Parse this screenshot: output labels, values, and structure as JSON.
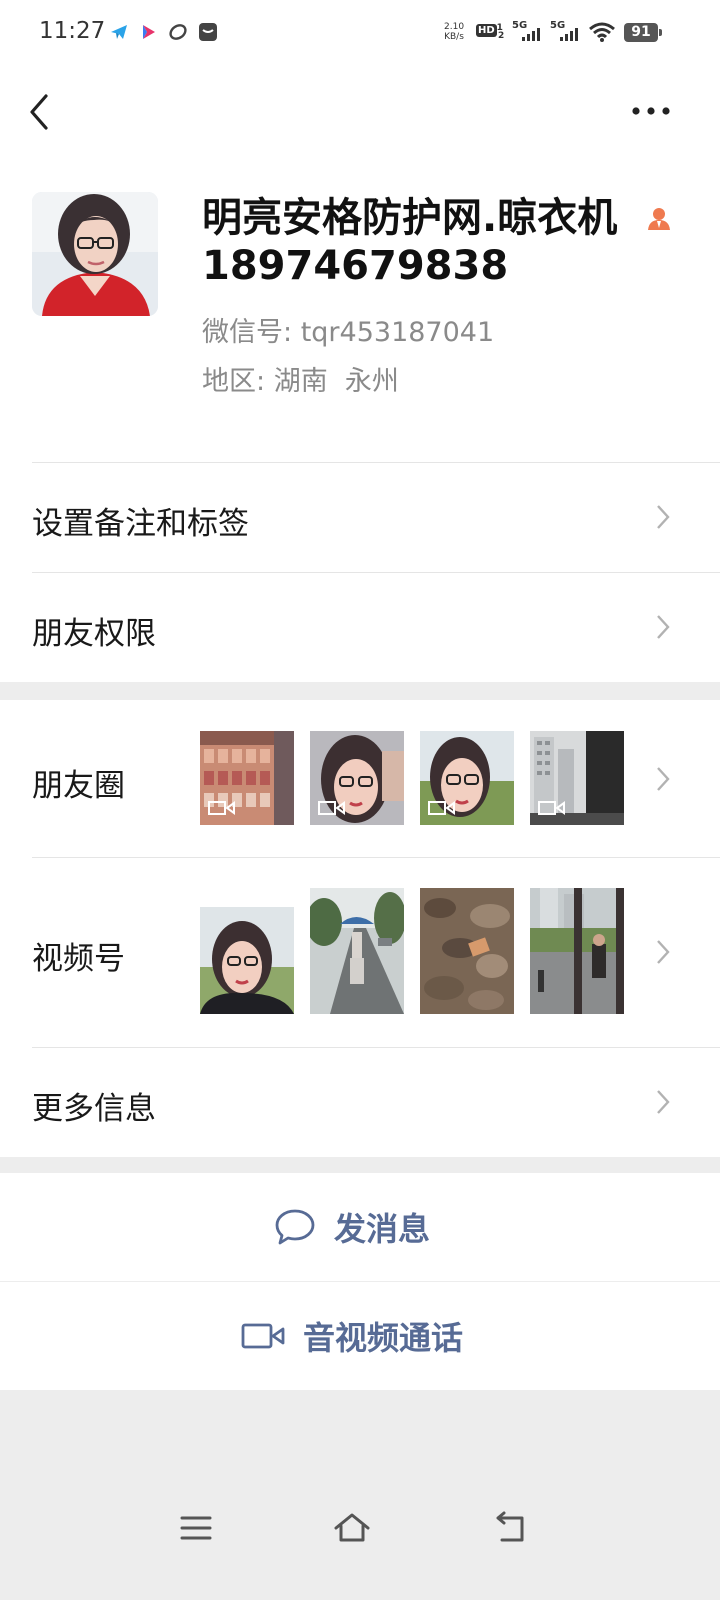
{
  "status_bar": {
    "time": "11:27",
    "net_speed_top": "2.10",
    "net_speed_unit": "KB/s",
    "hd": "HD",
    "hd_sup": "1",
    "hd_sub": "2",
    "sig1": "5G",
    "sig2": "5G",
    "battery": "91",
    "app_icons": [
      "telegram-icon",
      "arrow-app-icon",
      "loop-app-icon",
      "message-app-icon"
    ]
  },
  "nav": {
    "back_icon": "chevron-left-icon",
    "more_icon": "more-dots-icon"
  },
  "profile": {
    "name": "明亮安格防护网.晾衣机18974679838",
    "wechat_id_label": "微信号:",
    "wechat_id": "tqr453187041",
    "region_label": "地区:",
    "region": "湖南  永州",
    "avatar_icon": "avatar",
    "name_icon": "person-icon"
  },
  "rows": {
    "remark": "设置备注和标签",
    "permissions": "朋友权限",
    "moments": "朋友圈",
    "channels": "视频号",
    "more_info": "更多信息"
  },
  "actions": {
    "message": "发消息",
    "call": "音视频通话"
  },
  "colors": {
    "link_blue": "#576b95",
    "background": "#ededed",
    "white": "#ffffff"
  }
}
